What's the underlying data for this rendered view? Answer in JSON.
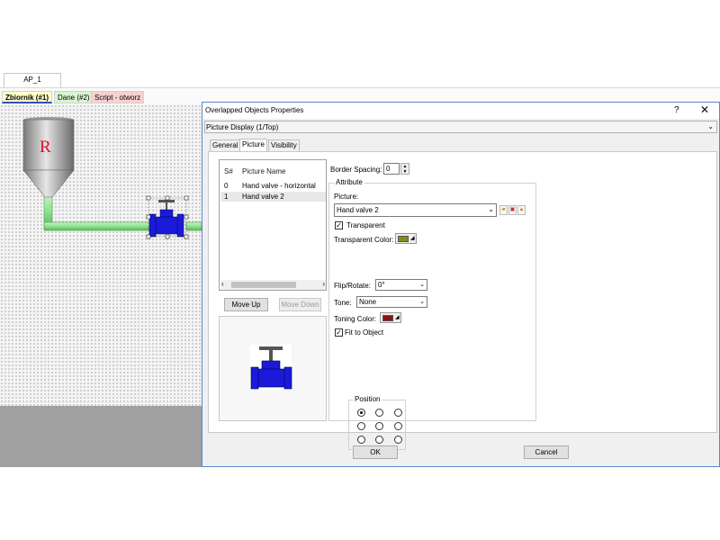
{
  "app": {
    "window_tab": "AP_1"
  },
  "doc_tabs": [
    {
      "label": "Zbiornik (#1)",
      "color": "#ffffc8"
    },
    {
      "label": "Dane (#2)",
      "color": "#d8f5d0"
    },
    {
      "label": "Script - otworz",
      "color": "#f8d0d0"
    }
  ],
  "canvas": {
    "tank_logo": "R"
  },
  "dialog": {
    "title": "Overlapped Objects Properties",
    "help_label": "?",
    "close_label": "✕",
    "display_select": "Picture Display (1/Top)",
    "tabs": [
      "General",
      "Picture",
      "Visibility"
    ],
    "active_tab": "Picture",
    "list": {
      "col_num": "S#",
      "col_name": "Picture Name",
      "rows": [
        {
          "num": "0",
          "name": "Hand valve - horizontal"
        },
        {
          "num": "1",
          "name": "Hand valve 2"
        }
      ],
      "selected_index": 1
    },
    "move_up": "Move Up",
    "move_down": "Move Down",
    "border_spacing_label": "Border Spacing:",
    "border_spacing_value": "0",
    "attribute_label": "Attribute",
    "picture_label": "Picture:",
    "picture_value": "Hand valve 2",
    "transparent_label": "Transparent",
    "transparent_checked": true,
    "transparent_color_label": "Transparent Color:",
    "transparent_color": "#8c8c14",
    "flip_label": "Flip/Rotate:",
    "flip_value": "0°",
    "tone_label": "Tone:",
    "tone_value": "None",
    "toning_color_label": "Toning Color:",
    "toning_color": "#8c1414",
    "fit_label": "Fit to Object",
    "fit_checked": true,
    "position_label": "Position",
    "position_selected": 0,
    "ok": "OK",
    "cancel": "Cancel"
  }
}
